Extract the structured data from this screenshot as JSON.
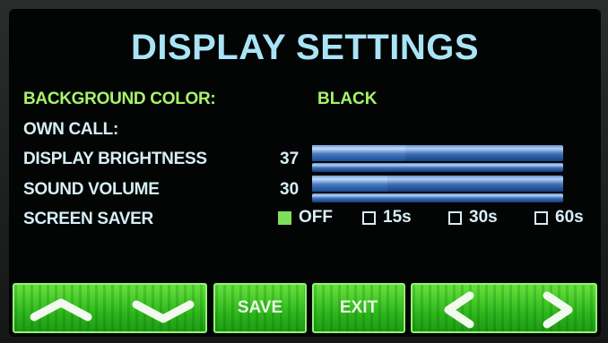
{
  "title": "DISPLAY SETTINGS",
  "settings": {
    "background_color": {
      "label": "BACKGROUND COLOR:",
      "value": "BLACK"
    },
    "own_call": {
      "label": "OWN CALL:"
    },
    "display_brightness": {
      "label": "DISPLAY BRIGHTNESS",
      "value": "37"
    },
    "sound_volume": {
      "label": "SOUND VOLUME",
      "value": "30"
    },
    "screen_saver": {
      "label": "SCREEN SAVER",
      "options": [
        {
          "label": "OFF",
          "checked": true
        },
        {
          "label": "15s",
          "checked": false
        },
        {
          "label": "30s",
          "checked": false
        },
        {
          "label": "60s",
          "checked": false
        }
      ]
    }
  },
  "buttons": {
    "up": "up-arrow-icon",
    "down": "down-arrow-icon",
    "save": "SAVE",
    "exit": "EXIT",
    "left": "left-arrow-icon",
    "right": "right-arrow-icon"
  },
  "colors": {
    "title": "#a9e4f6",
    "highlight": "#a8f36a",
    "button": "#3fc726"
  }
}
